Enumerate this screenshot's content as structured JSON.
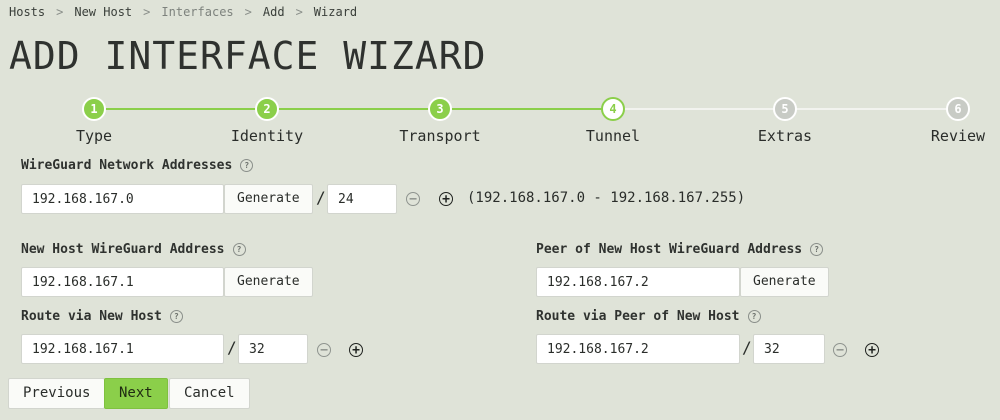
{
  "breadcrumb": [
    "Hosts",
    "New Host",
    "Interfaces",
    "Add",
    "Wizard"
  ],
  "title": "ADD INTERFACE WIZARD",
  "steps": [
    {
      "num": "1",
      "label": "Type",
      "state": "done"
    },
    {
      "num": "2",
      "label": "Identity",
      "state": "done"
    },
    {
      "num": "3",
      "label": "Transport",
      "state": "done"
    },
    {
      "num": "4",
      "label": "Tunnel",
      "state": "current"
    },
    {
      "num": "5",
      "label": "Extras",
      "state": "todo"
    },
    {
      "num": "6",
      "label": "Review",
      "state": "todo"
    }
  ],
  "network": {
    "label": "WireGuard Network Addresses",
    "address": "192.168.167.0",
    "generate": "Generate",
    "slash": "/",
    "prefix": "24",
    "range": "(192.168.167.0 - 192.168.167.255)"
  },
  "host_address": {
    "label": "New Host WireGuard Address",
    "value": "192.168.167.1",
    "generate": "Generate"
  },
  "peer_address": {
    "label": "Peer of New Host WireGuard Address",
    "value": "192.168.167.2",
    "generate": "Generate"
  },
  "route_host": {
    "label": "Route via New Host",
    "address": "192.168.167.1",
    "slash": "/",
    "prefix": "32"
  },
  "route_peer": {
    "label": "Route via Peer of New Host",
    "address": "192.168.167.2",
    "slash": "/",
    "prefix": "32"
  },
  "buttons": {
    "previous": "Previous",
    "next": "Next",
    "cancel": "Cancel"
  },
  "icons": {
    "help": "?",
    "minus": "−",
    "plus": "+"
  },
  "colors": {
    "accent": "#8bcf4a",
    "background": "#dfe3d8"
  }
}
